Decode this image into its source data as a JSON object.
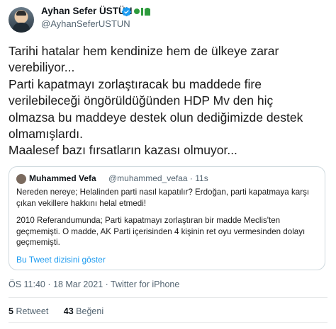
{
  "author": {
    "name": "Ayhan Sefer ÜSTÜN",
    "handle": "@AyhanSeferUSTUN"
  },
  "tweet": {
    "lines": [
      "Tarihi hatalar hem kendinize hem de ülkeye zarar",
      "verebiliyor...",
      "Parti kapatmayı zorlaştıracak bu maddede fire",
      "verilebileceği öngörüldüğünden HDP Mv den hiç",
      "olmazsa bu maddeye destek olun dediğimizde destek",
      "olmamışlardı.",
      "Maalesef bazı fırsatların kazası olmuyor..."
    ]
  },
  "quoted": {
    "name": "Muhammed Vefa",
    "handle_time": "@muhammed_vefaa · 11s",
    "para1": [
      "Nereden nereye; Helalinden parti nasıl kapatılır? Erdoğan, parti kapatmaya karşı",
      "çıkan vekillere hakkını helal etmedi!"
    ],
    "para2": [
      "2010 Referandumunda; Parti kapatmayı zorlaştıran bir madde Meclis'ten",
      "geçmemişti. O madde, AK Parti içerisinden 4 kişinin ret oyu vermesinden dolayı",
      "geçmemişti."
    ],
    "link": "Bu Tweet dizisini göster"
  },
  "meta": "ÖS 11:40 · 18 Mar 2021 · Twitter for iPhone",
  "stats": {
    "retweets": "5",
    "retweets_label": "Retweet",
    "likes": "43",
    "likes_label": "Beğeni"
  },
  "colors": {
    "accent": "#1d9bf0",
    "muted": "#536471",
    "party_green": "#2e9b3d"
  },
  "icons": [
    "verified-icon",
    "party-logo-icon"
  ]
}
